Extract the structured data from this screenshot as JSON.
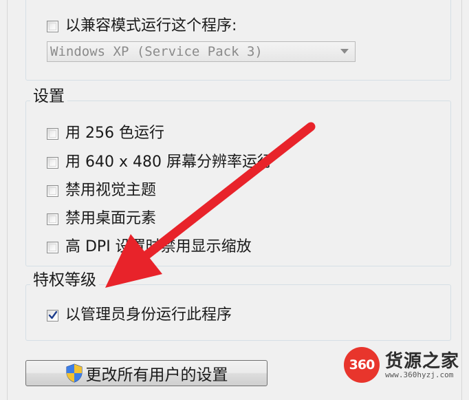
{
  "compat_group": {
    "checkbox": {
      "label": "以兼容模式运行这个程序:",
      "checked": false
    },
    "os_select": {
      "value": "Windows XP (Service Pack 3)"
    }
  },
  "settings_group": {
    "title": "设置",
    "items": [
      {
        "label": "用 256 色运行",
        "checked": false
      },
      {
        "label": "用 640 x 480 屏幕分辨率运行",
        "checked": false
      },
      {
        "label": "禁用视觉主题",
        "checked": false
      },
      {
        "label": "禁用桌面元素",
        "checked": false
      },
      {
        "label": "高 DPI 设置时禁用显示缩放",
        "checked": false
      }
    ]
  },
  "privilege_group": {
    "title": "特权等级",
    "run_as_admin": {
      "label": "以管理员身份运行此程序",
      "checked": true
    }
  },
  "all_users_button": {
    "label": "更改所有用户的设置",
    "icon": "uac-shield-icon"
  },
  "annotation": {
    "type": "red-arrow",
    "color": "#e8232a"
  },
  "watermark": {
    "logo_text": "360",
    "brand": "货源之家",
    "url": "www.360hyzj.com",
    "logo_color": "#e8352c"
  }
}
